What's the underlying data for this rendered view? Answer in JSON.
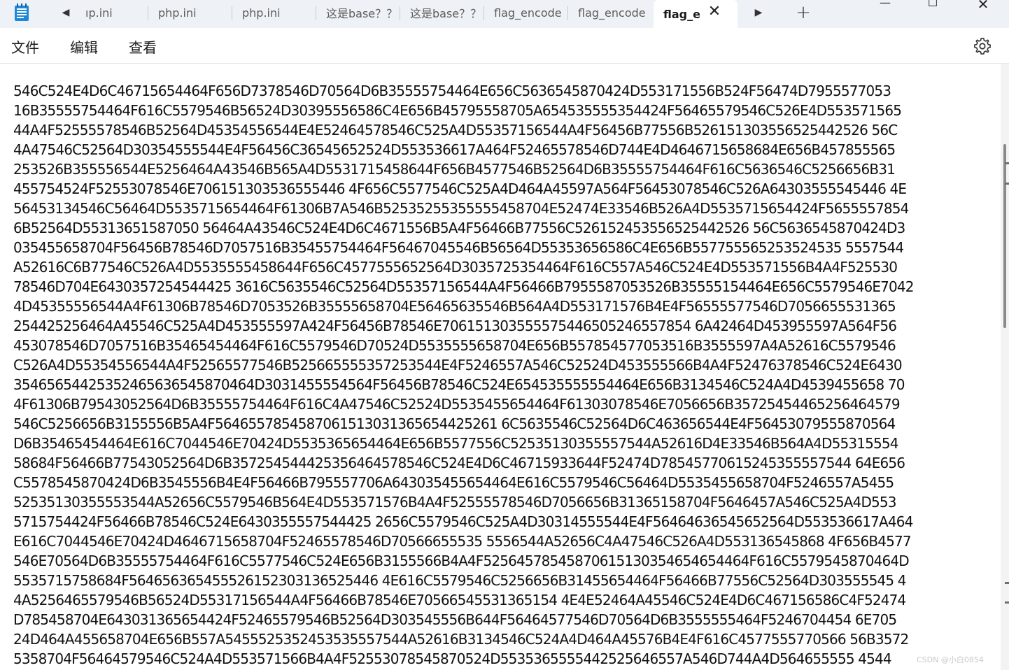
{
  "tabs": [
    {
      "label": "ıp.ini",
      "active": false
    },
    {
      "label": "php.ini",
      "active": false
    },
    {
      "label": "php.ini",
      "active": false
    },
    {
      "label": "这是base？？",
      "active": false
    },
    {
      "label": "这是base？？",
      "active": false
    },
    {
      "label": "flag_encode",
      "active": false
    },
    {
      "label": "flag_encode",
      "active": false
    },
    {
      "label": "flag_e",
      "active": true
    }
  ],
  "tab_close_glyph": "✕",
  "nav": {
    "prev_glyph": "◀",
    "next_glyph": "▶",
    "new_tab_glyph": "+"
  },
  "window": {
    "min_glyph": "—",
    "max_glyph": "☐",
    "close_glyph": "✕"
  },
  "menu": {
    "file": "文件",
    "edit": "编辑",
    "view": "查看"
  },
  "icons": {
    "app": "notepad-icon",
    "settings": "gear-icon"
  },
  "colors": {
    "tabbar_bg": "#eef1f5",
    "active_tab_bg": "#ffffff",
    "text": "#1a1a1a"
  },
  "editor": {
    "lines": [
      "546C524E4D6C46715654464F656D7378546D70564D6B35555754464E656C5636545870424D553171556B524F56474D7955577053",
      "16B35555754464F616C5579546B56524D30395556586C4E656B45795558705A654535555354424F56465579546C526E4D553571565",
      "44A4F52555578546B52564D45354556544E4E52464578546C525A4D55357156544A4F56456B77556B526151303556525442526 56C",
      "4A47546C52564D30354555544E4F56456C36545652524D553536617A464F52465578546D744E4D4646715658684E656B457855565",
      "253526B355556544E5256464A43546B565A4D5531715458644F656B4577546B52564D6B35555754464F616C5636546C5256656B31",
      "455754524F52553078546E706151303536555446 4F656C5577546C525A4D464A45597A564F56453078546C526A64303555545446 4E",
      "56453134546C56464D5535715654464F61306B7A546B52535255355555458704E52474E33546B526A4D5535715654424F5655557854",
      "6B52564D55313651587050 56464A43546C524E4D6C4671556B5A4F56466B77556C526152453556525442526 56C5636545870424D3",
      "035455658704F56456B78546D7057516B35455754464F56467045546B56564D55353656586C4E656B557755565253524535 5557544",
      "A52616C6B77546C526A4D5535555458644F656C4577555652564D3035725354464F616C557A546C524E4D553571556B4A4F525530",
      "78546D704E6430357254544425 3616C5635546C52564D55357156544A4F56466B7955587053526B35555154464E656C5579546E7042",
      "4D45355556544A4F61306B78546D7053526B35555658704E56465635546B564A4D553171576B4E4F56555577546D7056655531365",
      "254425256464A45546C525A4D453555597A424F56456B78546E706151303555575446505246557854 6A42464D453955597A564F56",
      "453078546D7057516B35465454464F616C5579546D70524D5535555658704E656B557854577053516B3555597A4A52616C5579546",
      "C526A4D55354556544A4F52565577546B525665555357253544E4F5246557A546C52524D453555566B4A4F52476378546C524E6430",
      "35465654425352465636545870464D3031455554564F56456B78546C524E654535555554464E656B3134546C524A4D4539455658 70",
      "4F61306B79543052564D6B35555754464F616C4A47546C52524D5535455654464F61303078546E7056656B35725454465256464579",
      "546C5256656B3155556B5A4F5646557854587061513031365654425261 6C5635546C52564D6C463656544E4F56453079555870564",
      "D6B35465454464E616C7044546E70424D5535365654464E656B5577556C52535130355557544A52616D4E33546B564A4D55315554",
      "58684F56466B77543052564D6B357254544425356464578546C524E4D6C46715933644F52474D78545770615245355557544 64E656",
      "C5578545870424D6B3545556B4E4F56466B795557706A643035455654464E616C5579546C56464D5535455658704F5246557A5455",
      "52535130355553544A52656C5579546B564E4D553571576B4A4F52555578546D7056656B31365158704F5646457A546C525A4D553",
      "5715754424F56466B78546C524E6430355557544425 2656C5579546C525A4D30314555544E4F56464636545652564D553536617A464",
      "E616C7044546E70424D4646715658704F52465578546D70566655535 5556544A52656C4A47546C526A4D553136545868 4F656B4577",
      "546E70564D6B35555754464F616C5577546C524E656B3155566B4A4F52564578545870615130354654654464F616C5579545870464D",
      "5535715758684F564656365455526152303136525446 4E616C5579546C5256656B31455654464F56466B77556C52564D303555545 4",
      "4A5256465579546B56524D55317156544A4F56466B78546E70566545531365154 4E4E52464A45546C524E4D6C467156586C4F52474",
      "D785458704E643031365654424F52465579546B52564D303545556B644F56464577546D70564D6B3555555464F5246704454 6E705",
      "24D464A455658704E656B557A5455525352453535557544A52616B3134546C524A4D464A45576B4E4F616C4577555770566 56B3572",
      "5358704F56464579546C524A4D553571566B4A4F52553078545870524D5535365555442525646557A546D744A4D564655555 4544"
    ]
  },
  "watermark": "CSDN @小白0854"
}
